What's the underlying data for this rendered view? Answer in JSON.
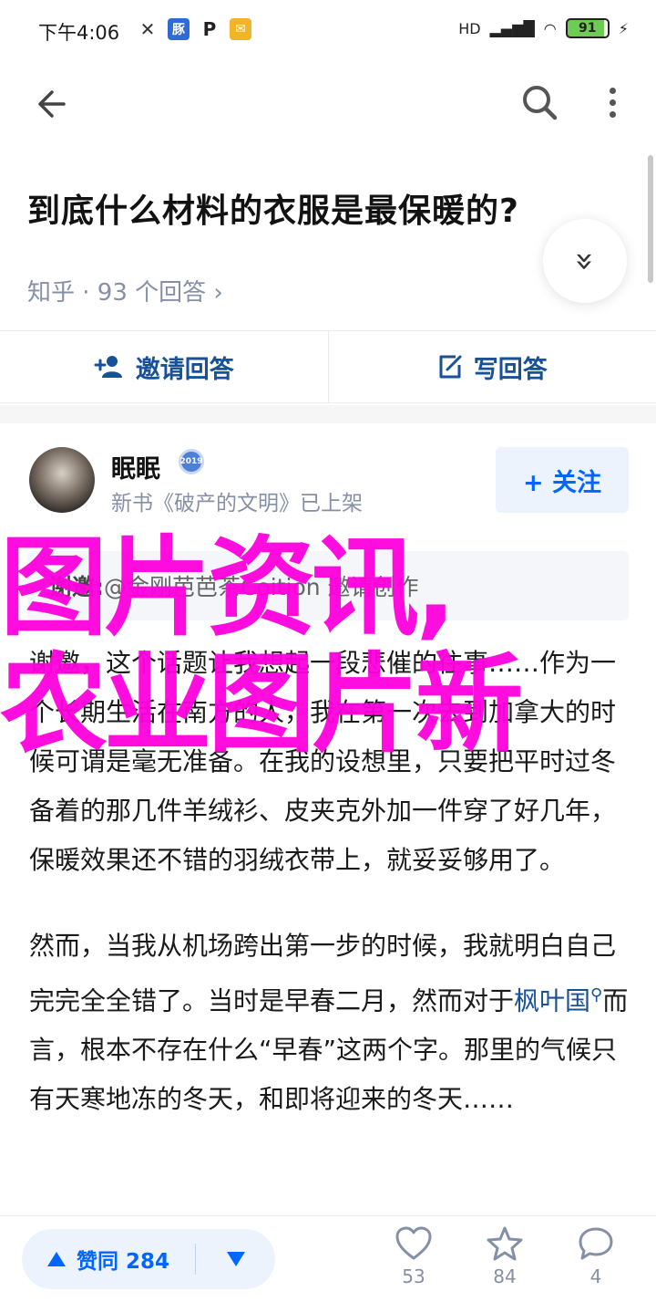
{
  "status_bar": {
    "time": "下午4:06",
    "network": "HD",
    "battery": "91",
    "badge_label": "豚",
    "p_label": "P"
  },
  "question": {
    "title": "到底什么材料的衣服是最保暖的?",
    "meta": "知乎 · 93 个回答 ›",
    "expand_label": "»"
  },
  "actions": {
    "invite_label": "邀请回答",
    "write_label": "写回答"
  },
  "author": {
    "name": "眠眠",
    "badge": "2019",
    "bio": "新书《破产的文明》已上架",
    "follow_label": "+ 关注"
  },
  "invite": {
    "prefix": "谢邀:",
    "text": "@金刚芭芭茶Coition 邀请创作"
  },
  "answer": {
    "para1": "谢邀，这个话题让我想起一段悲催的往事……作为一个长期生活在南方的人，我在第一次去到加拿大的时候可谓是毫无准备。在我的设想里，只要把平时过冬备着的那几件羊绒衫、皮夹克外加一件穿了好几年，保暖效果还不错的羽绒衣带上，就妥妥够用了。",
    "para2_a": "然而，当我从机场跨出第一步的时候，我就明白自己完完全全错了。当时是早春二月，然而对于",
    "para2_link": "枫叶国",
    "para2_b": "而言，根本不存在什么“早春”这两个字。那里的气候只有天寒地冻的冬天，和即将迎来的冬天……"
  },
  "watermark": {
    "line1": "图片资讯,",
    "line2": "农业图片新"
  },
  "bottom": {
    "upvote_label": "赞同 284",
    "likes": "53",
    "favorites": "84",
    "comments": "4"
  },
  "colors": {
    "link": "#175199",
    "accent": "#0066ff",
    "meta": "#8590a6",
    "watermark": "#ff00dd"
  }
}
